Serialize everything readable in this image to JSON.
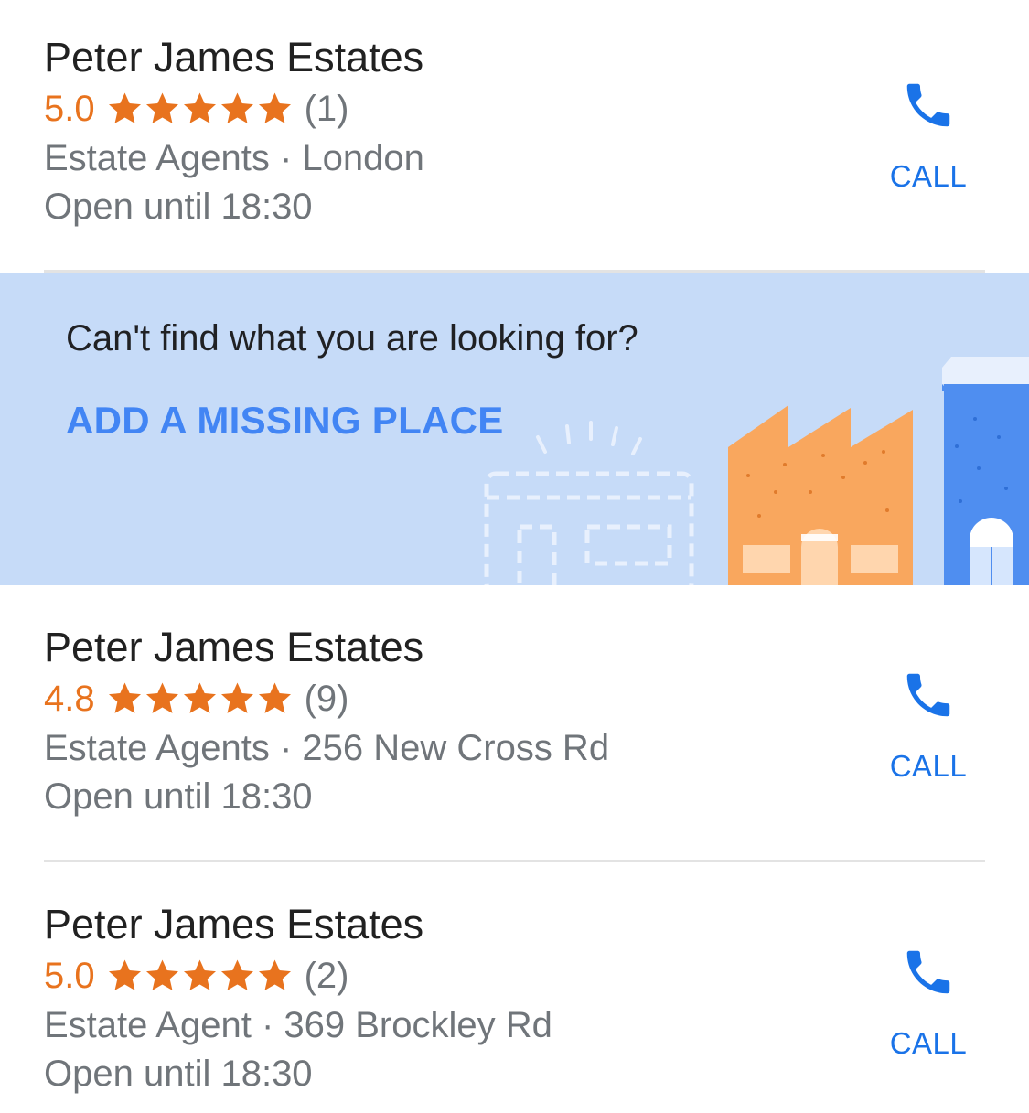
{
  "colors": {
    "rating": "#e8731e",
    "accent": "#1a73e8",
    "banner_bg": "#c6dbf8"
  },
  "listings": [
    {
      "name": "Peter James Estates",
      "rating": "5.0",
      "stars": 5,
      "reviews": "(1)",
      "meta": "Estate Agents · London",
      "hours": "Open until 18:30",
      "call_label": "CALL"
    },
    {
      "name": "Peter James Estates",
      "rating": "4.8",
      "stars": 5,
      "reviews": "(9)",
      "meta": "Estate Agents · 256 New Cross Rd",
      "hours": "Open until 18:30",
      "call_label": "CALL"
    },
    {
      "name": "Peter James Estates",
      "rating": "5.0",
      "stars": 5,
      "reviews": "(2)",
      "meta": "Estate Agent · 369 Brockley Rd",
      "hours": "Open until 18:30",
      "call_label": "CALL"
    }
  ],
  "banner": {
    "prompt": "Can't find what you are looking for?",
    "action": "ADD A MISSING PLACE"
  },
  "icons": {
    "call": "phone-icon",
    "star": "star-icon"
  }
}
